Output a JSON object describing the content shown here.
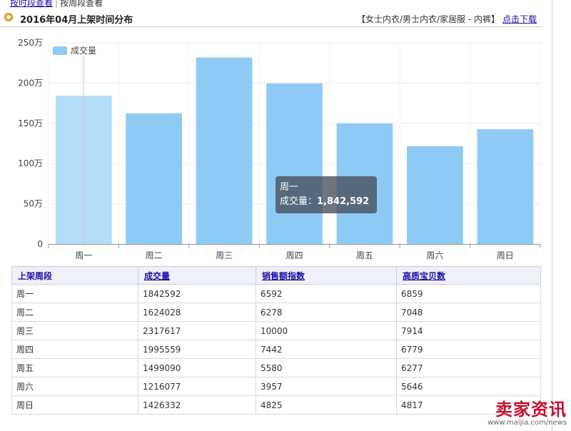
{
  "topnav": {
    "link1": "按时段查看",
    "sep": "|",
    "item2": "按周段查看"
  },
  "header": {
    "title": "2016年04月上架时间分布",
    "category": "【女士内衣/男士内衣/家居服 - 内裤】",
    "download": "点击下载"
  },
  "chart_data": {
    "type": "bar",
    "categories": [
      "周一",
      "周二",
      "周三",
      "周四",
      "周五",
      "周六",
      "周日"
    ],
    "series": [
      {
        "name": "成交量",
        "values": [
          1842592,
          1624028,
          2317617,
          1995559,
          1499090,
          1216077,
          1426332
        ]
      }
    ],
    "ylim": [
      0,
      2500000
    ],
    "yticks": [
      "0",
      "50万",
      "100万",
      "150万",
      "200万",
      "250万"
    ],
    "legend": "top-left",
    "grid": true,
    "colors": {
      "bar": "#8fcaf5",
      "highlight": "#b2dcf8"
    }
  },
  "tooltip": {
    "category": "周一",
    "label": "成交量：",
    "value": "1,842,592"
  },
  "table": {
    "headers": [
      "上架周段",
      "成交量",
      "销售额指数",
      "高质宝贝数"
    ],
    "rows": [
      [
        "周一",
        "1842592",
        "6592",
        "6859"
      ],
      [
        "周二",
        "1624028",
        "6278",
        "7048"
      ],
      [
        "周三",
        "2317617",
        "10000",
        "7914"
      ],
      [
        "周四",
        "1995559",
        "7442",
        "6779"
      ],
      [
        "周五",
        "1499090",
        "5580",
        "6277"
      ],
      [
        "周六",
        "1216077",
        "3957",
        "5646"
      ],
      [
        "周日",
        "1426332",
        "4825",
        "4817"
      ]
    ]
  },
  "watermark": {
    "brand": "卖家资讯",
    "url": "www.maijia.com/news"
  }
}
